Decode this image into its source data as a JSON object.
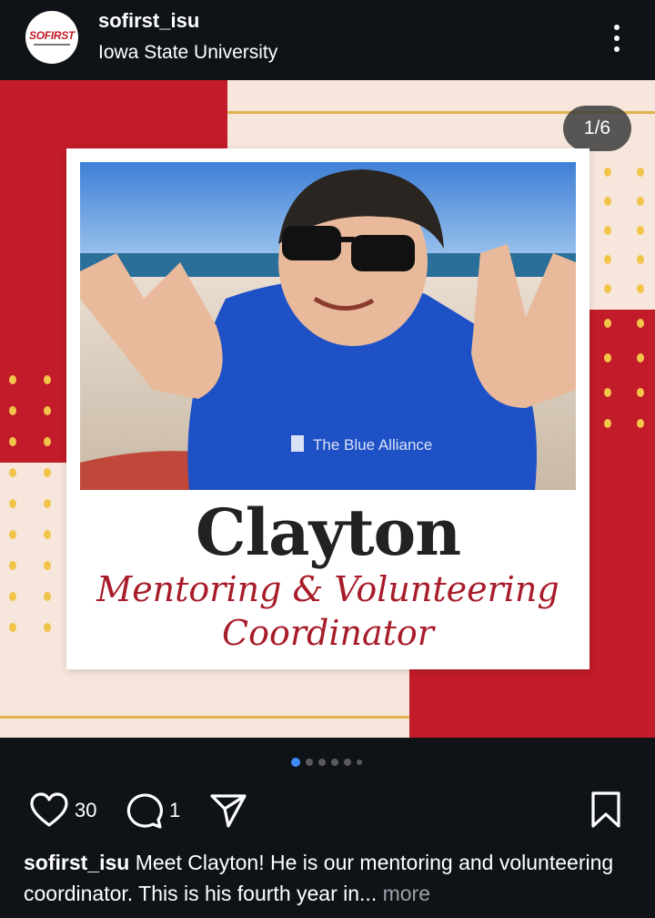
{
  "header": {
    "username": "sofirst_isu",
    "location": "Iowa State University",
    "avatar_logo": "SOFIRST"
  },
  "post": {
    "counter": "1/6",
    "name": "Clayton",
    "role_line1": "Mentoring & Volunteering",
    "role_line2": "Coordinator",
    "shirt_text": "The Blue Alliance",
    "carousel": {
      "total": 6,
      "active_index": 0
    }
  },
  "actions": {
    "likes": "30",
    "comments": "1",
    "icons": [
      "heart-icon",
      "comment-icon",
      "share-icon",
      "bookmark-icon"
    ]
  },
  "caption": {
    "username": "sofirst_isu",
    "text": " Meet Clayton! He is our mentoring and volunteering coordinator. This is his fourth year in",
    "ellipsis": "... ",
    "more": "more"
  },
  "colors": {
    "background": "#0f1318",
    "brand_red": "#c21b29",
    "cream": "#f7e6dc",
    "gold": "#f2c44a",
    "active_dot": "#3d8af7"
  }
}
